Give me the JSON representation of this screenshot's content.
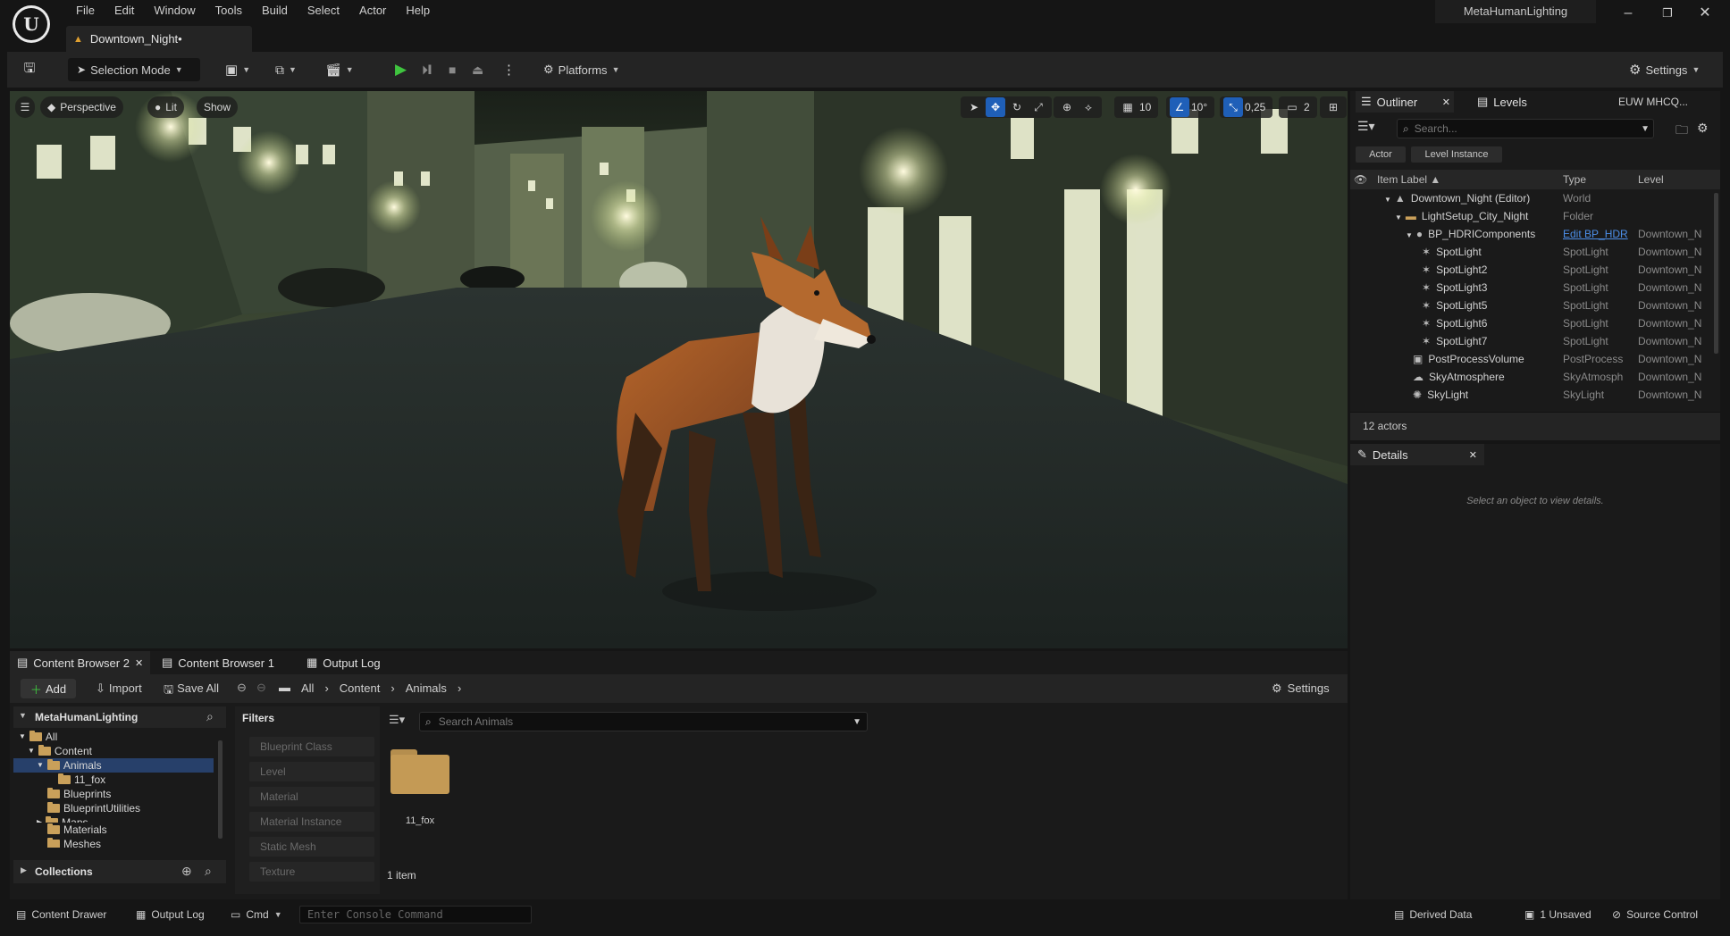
{
  "menu": [
    "File",
    "Edit",
    "Window",
    "Tools",
    "Build",
    "Select",
    "Actor",
    "Help"
  ],
  "document_tab": "Downtown_Night•",
  "project_name": "MetaHumanLighting",
  "toolbar": {
    "selection_mode": "Selection Mode",
    "platforms": "Platforms",
    "settings": "Settings"
  },
  "viewport": {
    "perspective": "Perspective",
    "lit": "Lit",
    "show": "Show",
    "grid_snap": "10",
    "rotation_snap": "10°",
    "scale_snap": "0,25",
    "camera_speed": "2"
  },
  "outliner": {
    "tab_outliner": "Outliner",
    "tab_levels": "Levels",
    "server": "EUW MHCQ...",
    "search_placeholder": "Search...",
    "filter_actor": "Actor",
    "filter_level_instance": "Level Instance",
    "col_label": "Item Label ▲",
    "col_type": "Type",
    "col_level": "Level",
    "rows": [
      {
        "label": "Downtown_Night (Editor)",
        "type": "World",
        "level": ""
      },
      {
        "label": "LightSetup_City_Night",
        "type": "Folder",
        "level": ""
      },
      {
        "label": "BP_HDRIComponents",
        "type": "Edit BP_HDR",
        "level": "Downtown_N"
      },
      {
        "label": "SpotLight",
        "type": "SpotLight",
        "level": "Downtown_N"
      },
      {
        "label": "SpotLight2",
        "type": "SpotLight",
        "level": "Downtown_N"
      },
      {
        "label": "SpotLight3",
        "type": "SpotLight",
        "level": "Downtown_N"
      },
      {
        "label": "SpotLight5",
        "type": "SpotLight",
        "level": "Downtown_N"
      },
      {
        "label": "SpotLight6",
        "type": "SpotLight",
        "level": "Downtown_N"
      },
      {
        "label": "SpotLight7",
        "type": "SpotLight",
        "level": "Downtown_N"
      },
      {
        "label": "PostProcessVolume",
        "type": "PostProcess",
        "level": "Downtown_N"
      },
      {
        "label": "SkyAtmosphere",
        "type": "SkyAtmosph",
        "level": "Downtown_N"
      },
      {
        "label": "SkyLight",
        "type": "SkyLight",
        "level": "Downtown_N"
      }
    ],
    "actor_count": "12 actors"
  },
  "details": {
    "tab": "Details",
    "empty_message": "Select an object to view details."
  },
  "content_browser": {
    "tabs": [
      "Content Browser 2",
      "Content Browser 1",
      "Output Log"
    ],
    "add": "Add",
    "import": "Import",
    "save_all": "Save All",
    "breadcrumb": [
      "All",
      "Content",
      "Animals"
    ],
    "settings": "Settings",
    "project": "MetaHumanLighting",
    "tree": [
      "All",
      "Content",
      "Animals",
      "11_fox",
      "Blueprints",
      "BlueprintUtilities",
      "Maps",
      "Materials",
      "Meshes"
    ],
    "collections": "Collections",
    "filters_title": "Filters",
    "filters": [
      "Blueprint Class",
      "Level",
      "Material",
      "Material Instance",
      "Static Mesh",
      "Texture"
    ],
    "search_placeholder": "Search Animals",
    "asset_name": "11_fox",
    "item_count": "1 item"
  },
  "status": {
    "content_drawer": "Content Drawer",
    "output_log": "Output Log",
    "cmd": "Cmd",
    "console_placeholder": "Enter Console Command",
    "derived_data": "Derived Data",
    "unsaved": "1 Unsaved",
    "source_control": "Source Control"
  }
}
